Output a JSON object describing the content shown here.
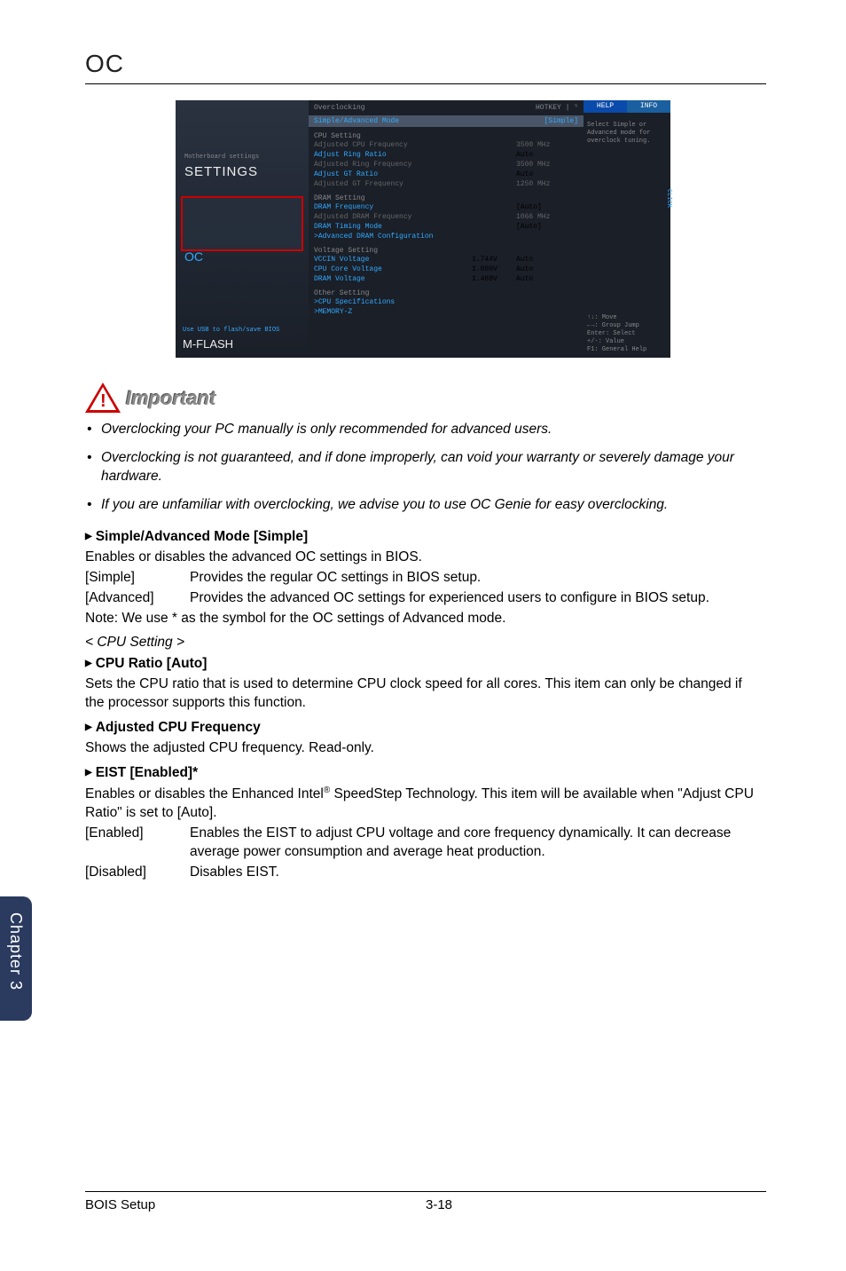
{
  "page": {
    "title": "OC"
  },
  "bios": {
    "left": {
      "settings_sub": "Motherboard settings",
      "settings": "SETTINGS",
      "oc": "OC",
      "mflash_sub": "Use USB to flash/save BIOS",
      "mflash": "M-FLASH"
    },
    "header": {
      "title": "Overclocking",
      "hotkey": "HOTKEY | ⁵"
    },
    "mode_row": {
      "label": "Simple/Advanced Mode",
      "value": "[Simple]"
    },
    "cpu_setting": {
      "title": "CPU Setting",
      "rows": [
        {
          "label": "Adjusted CPU Frequency",
          "val": "3500 MHz",
          "cls": "inactive"
        },
        {
          "label": "Adjust Ring Ratio",
          "val": "Auto",
          "cls": "active"
        },
        {
          "label": "Adjusted Ring Frequency",
          "val": "3500 MHz",
          "cls": "inactive"
        },
        {
          "label": "Adjust GT Ratio",
          "val": "Auto",
          "cls": "active"
        },
        {
          "label": "Adjusted GT Frequency",
          "val": "1250 MHz",
          "cls": "inactive"
        }
      ]
    },
    "dram_setting": {
      "title": "DRAM Setting",
      "rows": [
        {
          "label": "DRAM Frequency",
          "val": "[Auto]",
          "cls": "active"
        },
        {
          "label": "Adjusted DRAM Frequency",
          "val": "1066 MHz",
          "cls": "inactive"
        },
        {
          "label": "DRAM Timing Mode",
          "val": "[Auto]",
          "cls": "active"
        }
      ],
      "adv": "Advanced DRAM Configuration"
    },
    "voltage_setting": {
      "title": "Voltage Setting",
      "rows": [
        {
          "label": "VCCIN Voltage",
          "mid": "1.744V",
          "val": "Auto",
          "cls": "active"
        },
        {
          "label": "CPU Core Voltage",
          "mid": "1.009V",
          "val": "Auto",
          "cls": "active"
        },
        {
          "label": "DRAM Voltage",
          "mid": "1.488V",
          "val": "Auto",
          "cls": "active"
        }
      ]
    },
    "other_setting": {
      "title": "Other Setting",
      "rows": [
        {
          "label": "CPU Specifications"
        },
        {
          "label": "MEMORY-Z"
        }
      ]
    },
    "right": {
      "tab1": "HELP",
      "tab2": "INFO",
      "help": "Select Simple or Advanced mode for overclock tuning.",
      "click": "CLICK",
      "hk1": "↑↓: Move",
      "hk2": "←→: Group Jump",
      "hk3": "Enter: Select",
      "hk4": "+/-: Value",
      "hk5": "F1: General Help"
    }
  },
  "important": {
    "label": "Important"
  },
  "bullets": [
    "Overclocking your PC manually is only recommended for advanced users.",
    "Overclocking is not guaranteed, and if done improperly, can void your warranty or severely damage your hardware.",
    "If you are unfamiliar with overclocking, we advise you to use OC Genie for easy overclocking."
  ],
  "settings": {
    "simple": {
      "title": "Simple/Advanced Mode [Simple]",
      "desc": "Enables or disables the advanced OC settings in BIOS.",
      "opts": [
        {
          "label": "[Simple]",
          "desc": "Provides the regular OC settings in BIOS setup."
        },
        {
          "label": "[Advanced]",
          "desc": "Provides the advanced OC settings for experienced users to configure in BIOS setup."
        }
      ],
      "note": "Note: We use * as the symbol for the OC settings of Advanced mode."
    },
    "cpu_hdr": "< CPU Setting >",
    "cpu_ratio": {
      "title": "CPU Ratio [Auto]",
      "desc": "Sets the CPU ratio that is used to determine CPU clock speed for all cores. This item can only be changed if the processor supports this function."
    },
    "adj_freq": {
      "title": "Adjusted CPU Frequency",
      "desc": "Shows the adjusted CPU frequency. Read-only."
    },
    "eist": {
      "title": "EIST [Enabled]*",
      "desc_pre": "Enables or disables the Enhanced Intel",
      "desc_post": " SpeedStep Technology. This item will be available when \"Adjust CPU Ratio\" is set to [Auto].",
      "opts": [
        {
          "label": "[Enabled]",
          "desc": "Enables the EIST to adjust CPU voltage and core frequency dynamically. It can decrease average power consumption and average heat production."
        },
        {
          "label": "[Disabled]",
          "desc": "Disables EIST."
        }
      ]
    }
  },
  "sidetab": "Chapter 3",
  "footer": {
    "left": "BOIS Setup",
    "right": "3-18"
  }
}
